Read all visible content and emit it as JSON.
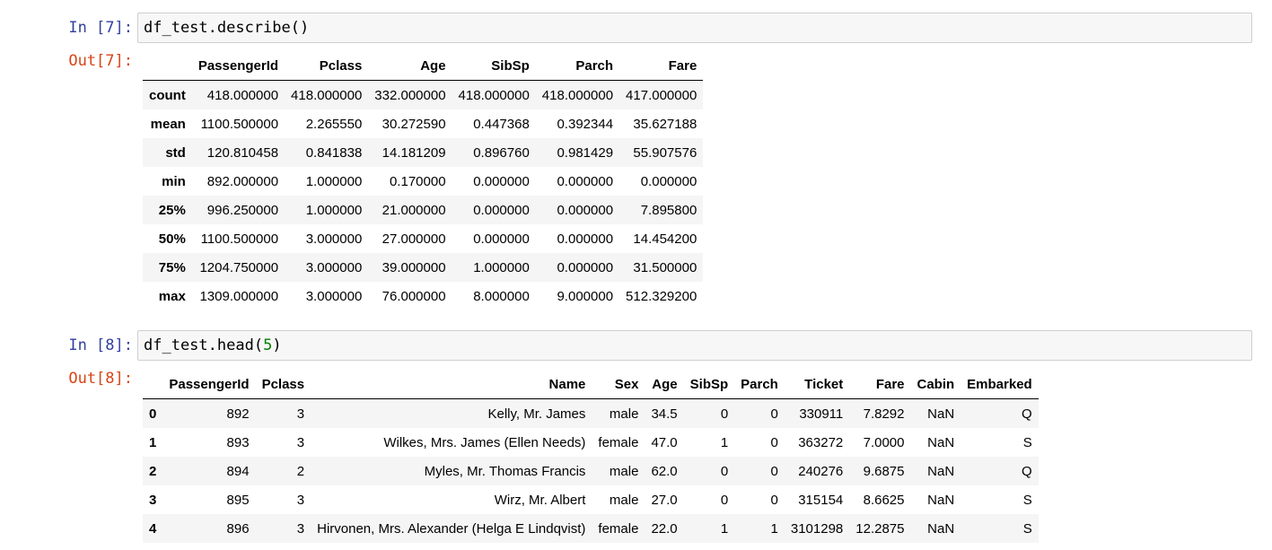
{
  "cells": [
    {
      "in_prompt": "In [7]:",
      "code": "df_test.describe()",
      "out_prompt": "Out[7]:"
    },
    {
      "in_prompt": "In [8]:",
      "code_prefix": "df_test.head(",
      "code_num": "5",
      "code_suffix": ")",
      "out_prompt": "Out[8]:"
    }
  ],
  "describe_table": {
    "columns": [
      "",
      "PassengerId",
      "Pclass",
      "Age",
      "SibSp",
      "Parch",
      "Fare"
    ],
    "rows": [
      {
        "index": "count",
        "values": [
          "418.000000",
          "418.000000",
          "332.000000",
          "418.000000",
          "418.000000",
          "417.000000"
        ]
      },
      {
        "index": "mean",
        "values": [
          "1100.500000",
          "2.265550",
          "30.272590",
          "0.447368",
          "0.392344",
          "35.627188"
        ]
      },
      {
        "index": "std",
        "values": [
          "120.810458",
          "0.841838",
          "14.181209",
          "0.896760",
          "0.981429",
          "55.907576"
        ]
      },
      {
        "index": "min",
        "values": [
          "892.000000",
          "1.000000",
          "0.170000",
          "0.000000",
          "0.000000",
          "0.000000"
        ]
      },
      {
        "index": "25%",
        "values": [
          "996.250000",
          "1.000000",
          "21.000000",
          "0.000000",
          "0.000000",
          "7.895800"
        ]
      },
      {
        "index": "50%",
        "values": [
          "1100.500000",
          "3.000000",
          "27.000000",
          "0.000000",
          "0.000000",
          "14.454200"
        ]
      },
      {
        "index": "75%",
        "values": [
          "1204.750000",
          "3.000000",
          "39.000000",
          "1.000000",
          "0.000000",
          "31.500000"
        ]
      },
      {
        "index": "max",
        "values": [
          "1309.000000",
          "3.000000",
          "76.000000",
          "8.000000",
          "9.000000",
          "512.329200"
        ]
      }
    ]
  },
  "head_table": {
    "columns": [
      "",
      "PassengerId",
      "Pclass",
      "Name",
      "Sex",
      "Age",
      "SibSp",
      "Parch",
      "Ticket",
      "Fare",
      "Cabin",
      "Embarked"
    ],
    "rows": [
      {
        "index": "0",
        "values": [
          "892",
          "3",
          "Kelly, Mr. James",
          "male",
          "34.5",
          "0",
          "0",
          "330911",
          "7.8292",
          "NaN",
          "Q"
        ]
      },
      {
        "index": "1",
        "values": [
          "893",
          "3",
          "Wilkes, Mrs. James (Ellen Needs)",
          "female",
          "47.0",
          "1",
          "0",
          "363272",
          "7.0000",
          "NaN",
          "S"
        ]
      },
      {
        "index": "2",
        "values": [
          "894",
          "2",
          "Myles, Mr. Thomas Francis",
          "male",
          "62.0",
          "0",
          "0",
          "240276",
          "9.6875",
          "NaN",
          "Q"
        ]
      },
      {
        "index": "3",
        "values": [
          "895",
          "3",
          "Wirz, Mr. Albert",
          "male",
          "27.0",
          "0",
          "0",
          "315154",
          "8.6625",
          "NaN",
          "S"
        ]
      },
      {
        "index": "4",
        "values": [
          "896",
          "3",
          "Hirvonen, Mrs. Alexander (Helga E Lindqvist)",
          "female",
          "22.0",
          "1",
          "1",
          "3101298",
          "12.2875",
          "NaN",
          "S"
        ]
      }
    ]
  }
}
